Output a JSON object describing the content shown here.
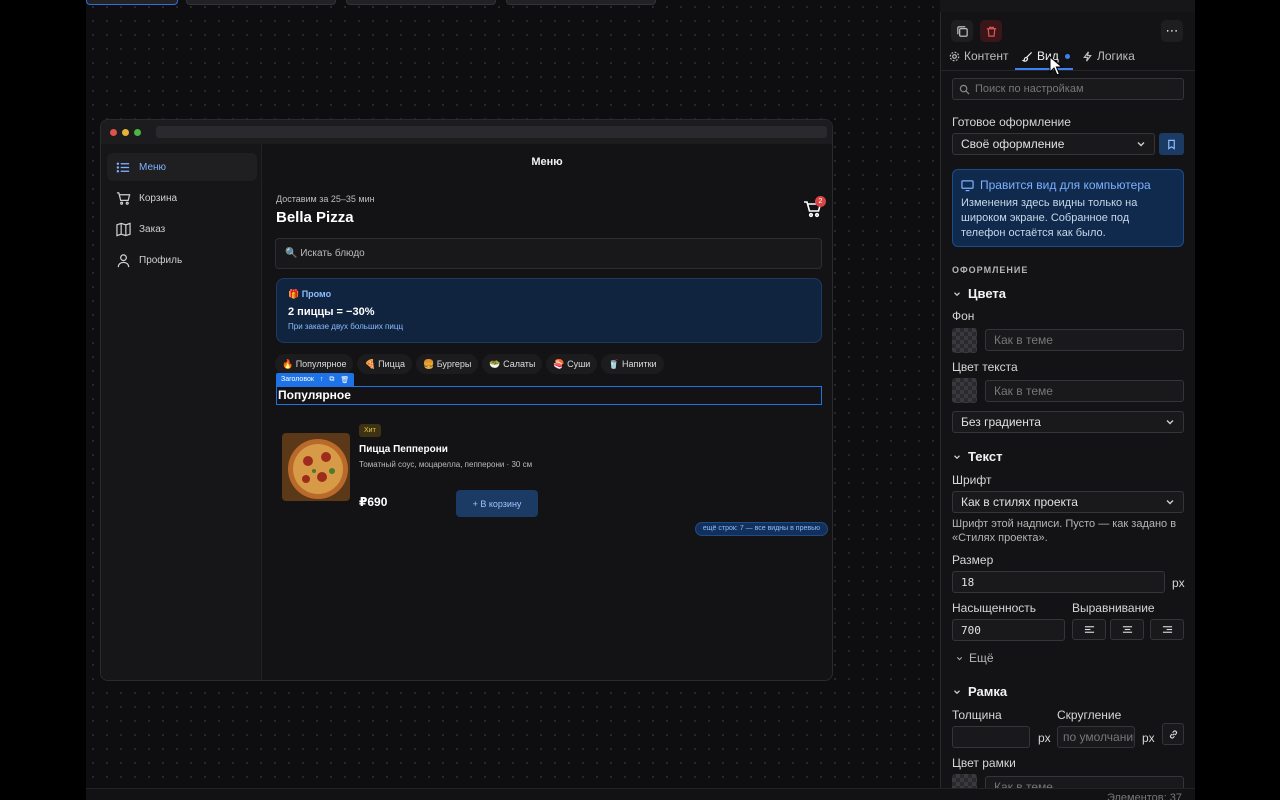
{
  "canvas": {
    "preview": {
      "sidebar": {
        "items": [
          {
            "label": "Меню",
            "icon": "list-icon",
            "active": true
          },
          {
            "label": "Корзина",
            "icon": "cart-icon"
          },
          {
            "label": "Заказ",
            "icon": "map-icon"
          },
          {
            "label": "Профиль",
            "icon": "user-icon"
          }
        ]
      },
      "page_title": "Меню",
      "delivery_text": "Доставим за 25–35 мин",
      "brand": "Bella Pizza",
      "cart_badge": "2",
      "search_text": "🔍 Искать блюдо",
      "promo": {
        "tag": "🎁 Промо",
        "deal": "2 пиццы = −30%",
        "subtitle": "При заказе двух больших пицц"
      },
      "chips": [
        "🔥 Популярное",
        "🍕 Пицца",
        "🍔 Бургеры",
        "🥗 Салаты",
        "🍣 Суши",
        "🥤 Напитки"
      ],
      "selection": {
        "element_type": "Заголовок",
        "heading_text": "Популярное"
      },
      "product": {
        "badge": "Хит",
        "name": "Пицца Пепперони",
        "description": "Томатный соус, моцарелла, пепперони · 30 см",
        "price": "₽690",
        "add_button": "+ В корзину"
      },
      "more_rows_note": "ещё строк: 7 — все видны в превью"
    },
    "element_count": "Элементов: 37"
  },
  "panel": {
    "tabs": [
      {
        "label": "Контент",
        "icon": "gear-icon"
      },
      {
        "label": "Вид",
        "icon": "brush-icon",
        "active": true
      },
      {
        "label": "Логика",
        "icon": "bolt-icon"
      }
    ],
    "search_placeholder": "Поиск по настройкам",
    "preset_label": "Готовое оформление",
    "preset_value": "Своё оформление",
    "info": {
      "title": "Правится вид для компьютера",
      "body": "Изменения здесь видны только на широком экране. Собранное под телефон остаётся как было."
    },
    "section_title": "ОФОРМЛЕНИЕ",
    "colors": {
      "heading": "Цвета",
      "bg_label": "Фон",
      "bg_placeholder": "Как в теме",
      "text_color_label": "Цвет текста",
      "text_color_placeholder": "Как в теме",
      "gradient_value": "Без градиента"
    },
    "text": {
      "heading": "Текст",
      "font_label": "Шрифт",
      "font_value": "Как в стилях проекта",
      "font_hint": "Шрифт этой надписи. Пусто — как задано в «Стилях проекта».",
      "size_label": "Размер",
      "size_value": "18",
      "size_unit": "px",
      "weight_label": "Насыщенность",
      "weight_value": "700",
      "align_label": "Выравнивание",
      "more": "Ещё"
    },
    "border": {
      "heading": "Рамка",
      "width_label": "Толщина",
      "width_unit": "px",
      "radius_label": "Скругление",
      "radius_placeholder": "по умолчанию",
      "radius_unit": "px",
      "color_label": "Цвет рамки",
      "color_placeholder": "Как в теме"
    }
  },
  "colors": {
    "accent": "#3b82f6",
    "selection": "#1e73e8",
    "danger": "#d94545"
  }
}
